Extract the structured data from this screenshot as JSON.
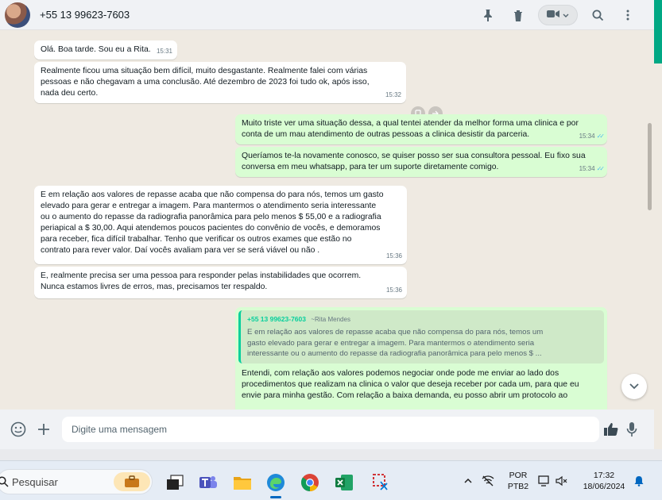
{
  "header": {
    "contact_name": "+55 13 99623-7603",
    "icons": [
      "pin-icon",
      "delete-icon",
      "video-call-icon",
      "chevron-down-icon",
      "search-icon",
      "menu-icon"
    ]
  },
  "messages": [
    {
      "dir": "in",
      "text": "Olá. Boa tarde. Sou eu a Rita.",
      "time": "15:31"
    },
    {
      "dir": "in",
      "text": "Realmente ficou uma situação bem difícil, muito desgastante. Realmente falei com várias\npessoas e não chegavam a uma conclusão. Até dezembro  de 2023 foi tudo ok, após isso,\nnada deu certo.",
      "time": "15:32"
    },
    {
      "dir": "out",
      "text": "Muito triste ver uma situação dessa, a qual tentei atender da melhor forma uma clinica e por\nconta de um mau atendimento de outras pessoas a clinica desistir da parceria.",
      "time": "15:34"
    },
    {
      "dir": "out",
      "text": "Queríamos te-la novamente conosco, se quiser posso ser sua consultora pessoal. Eu fixo sua\nconversa em meu whatsapp, para ter um suporte diretamente comigo.",
      "time": "15:34"
    },
    {
      "dir": "in",
      "text": "E em relação aos valores de repasse acaba que não compensa do para nós, temos um gasto\nelevado para gerar e entregar a imagem. Para mantermos o atendimento seria interessante\nou o aumento do repasse da radiografia panorâmica para pelo menos $ 55,00 e a radiografia\nperiapical a $ 30,00. Aqui atendemos poucos pacientes do convênio de vocês, e demoramos\npara receber, fica difícil trabalhar. Tenho que verificar os outros exames que estão no\ncontrato para rever valor. Daí vocês avaliam para ver se será viável ou não .",
      "time": "15:36"
    },
    {
      "dir": "in",
      "text": "E, realmente precisa ser uma pessoa para responder pelas instabilidades que ocorrem.\nNunca estamos livres de erros, mas, precisamos ter respaldo.",
      "time": "15:36"
    },
    {
      "dir": "out",
      "quote_author": "+55 13 99623-7603",
      "quote_author_name": "~Rita Mendes",
      "quote_text": "E em relação aos valores de repasse acaba que não compensa do para nós, temos um\ngasto elevado para gerar e entregar a imagem. Para mantermos o atendimento seria\ninteressante ou o aumento do repasse da radiografia panorâmica para pelo menos $ ...",
      "text": "Entendi, com relação aos valores podemos negociar onde pode me enviar ao lado dos\nprocedimentos que realizam na clinica o valor que deseja receber por cada um, para que eu\nenvie para minha gestão. Com relação a baixa demanda, eu posso abrir um protocolo ao"
    }
  ],
  "compose": {
    "placeholder": "Digite uma mensagem",
    "icons": [
      "emoji-icon",
      "attach-plus-icon",
      "thumbs-up-icon",
      "microphone-icon"
    ]
  },
  "taskbar": {
    "search_label": "Pesquisar",
    "apps": [
      "work-briefcase-icon",
      "task-view-icon",
      "teams-icon",
      "file-explorer-icon",
      "edge-icon",
      "chrome-icon",
      "excel-icon",
      "snipping-tool-icon"
    ],
    "lang_top": "POR",
    "lang_bottom": "PTB2",
    "time": "17:32",
    "date": "18/06/2024"
  },
  "colors": {
    "chat_bg": "#efeae2",
    "incoming": "#ffffff",
    "outgoing": "#d9fdd3",
    "accent": "#00a884",
    "read_ticks": "#53bdeb"
  }
}
